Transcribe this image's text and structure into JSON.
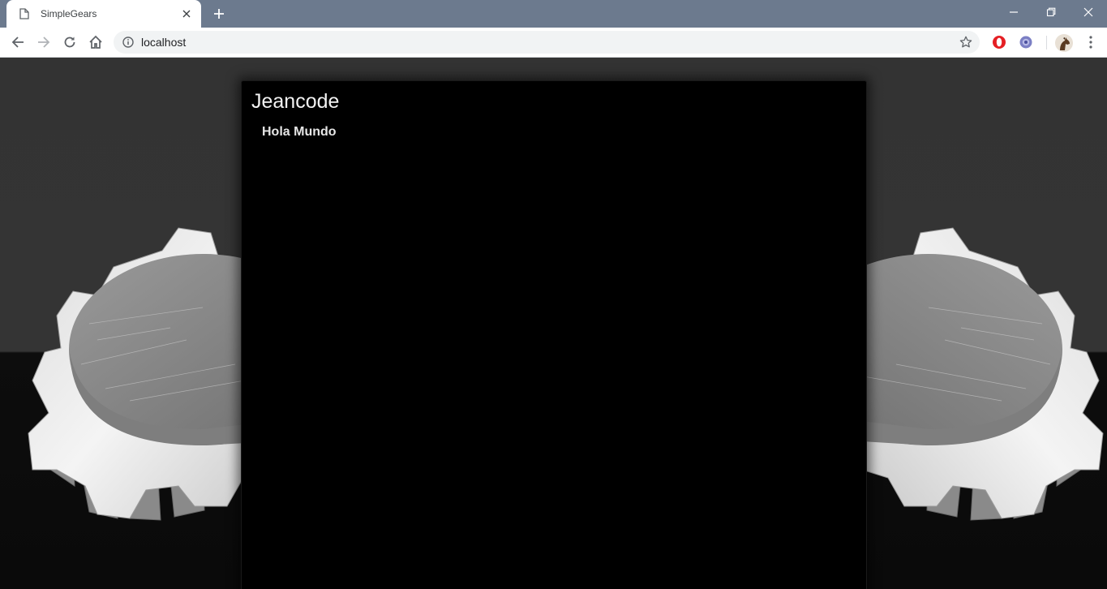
{
  "browser": {
    "tab": {
      "title": "SimpleGears",
      "icon": "page-icon"
    },
    "address_bar": {
      "url": "localhost"
    },
    "extensions": [
      "opera-icon",
      "web-extension-icon"
    ],
    "colors": {
      "titlebar": "#6c7a8e",
      "toolbar": "#ffffff",
      "omnibox": "#f1f3f4"
    }
  },
  "page": {
    "title": "Jeancode",
    "subtitle": "Hola Mundo",
    "colors": {
      "panel": "#000000",
      "backdrop_upper": "#333333",
      "backdrop_floor": "#0d0d0d",
      "text": "#f2f2f2"
    }
  }
}
